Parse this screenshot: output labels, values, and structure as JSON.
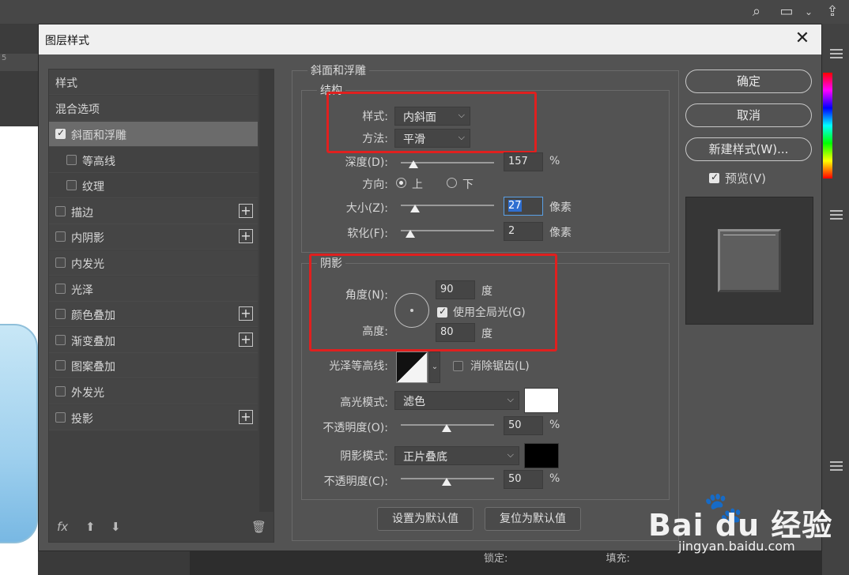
{
  "dialog": {
    "title": "图层样式",
    "close_glyph": "✕"
  },
  "styles_list": {
    "header": "样式",
    "blend_options": "混合选项",
    "items": [
      {
        "label": "斜面和浮雕",
        "checked": true,
        "selected": true,
        "plus": false,
        "indent": false
      },
      {
        "label": "等高线",
        "checked": false,
        "selected": false,
        "plus": false,
        "indent": true
      },
      {
        "label": "纹理",
        "checked": false,
        "selected": false,
        "plus": false,
        "indent": true
      },
      {
        "label": "描边",
        "checked": false,
        "selected": false,
        "plus": true,
        "indent": false
      },
      {
        "label": "内阴影",
        "checked": false,
        "selected": false,
        "plus": true,
        "indent": false
      },
      {
        "label": "内发光",
        "checked": false,
        "selected": false,
        "plus": false,
        "indent": false
      },
      {
        "label": "光泽",
        "checked": false,
        "selected": false,
        "plus": false,
        "indent": false
      },
      {
        "label": "颜色叠加",
        "checked": false,
        "selected": false,
        "plus": true,
        "indent": false
      },
      {
        "label": "渐变叠加",
        "checked": false,
        "selected": false,
        "plus": true,
        "indent": false
      },
      {
        "label": "图案叠加",
        "checked": false,
        "selected": false,
        "plus": false,
        "indent": false
      },
      {
        "label": "外发光",
        "checked": false,
        "selected": false,
        "plus": false,
        "indent": false
      },
      {
        "label": "投影",
        "checked": false,
        "selected": false,
        "plus": true,
        "indent": false
      }
    ],
    "footer": {
      "fx": "fx",
      "up": "⬆",
      "down": "⬇",
      "trash": "🗑"
    }
  },
  "bevel": {
    "section_title": "斜面和浮雕",
    "structure": {
      "title": "结构",
      "style_label": "样式:",
      "style_value": "内斜面",
      "technique_label": "方法:",
      "technique_value": "平滑",
      "depth_label": "深度(D):",
      "depth_value": "157",
      "depth_unit": "%",
      "direction_label": "方向:",
      "direction_up": "上",
      "direction_down": "下",
      "size_label": "大小(Z):",
      "size_value": "27",
      "size_unit": "像素",
      "soften_label": "软化(F):",
      "soften_value": "2",
      "soften_unit": "像素"
    },
    "shading": {
      "title": "阴影",
      "angle_label": "角度(N):",
      "angle_value": "90",
      "angle_unit": "度",
      "global_light_label": "使用全局光(G)",
      "altitude_label": "高度:",
      "altitude_value": "80",
      "altitude_unit": "度",
      "gloss_contour_label": "光泽等高线:",
      "antialias_label": "消除锯齿(L)",
      "highlight_mode_label": "高光模式:",
      "highlight_mode_value": "滤色",
      "highlight_color": "#ffffff",
      "highlight_opacity_label": "不透明度(O):",
      "highlight_opacity_value": "50",
      "highlight_opacity_unit": "%",
      "shadow_mode_label": "阴影模式:",
      "shadow_mode_value": "正片叠底",
      "shadow_color": "#000000",
      "shadow_opacity_label": "不透明度(C):",
      "shadow_opacity_value": "50",
      "shadow_opacity_unit": "%"
    },
    "make_default": "设置为默认值",
    "reset_default": "复位为默认值"
  },
  "right_column": {
    "ok": "确定",
    "cancel": "取消",
    "new_style": "新建样式(W)...",
    "preview_label": "预览(V)"
  },
  "background": {
    "ruler_tick": "5",
    "lock_label": "锁定:",
    "fill_label": "填充:"
  },
  "watermark": {
    "brand": "Bai du 经验",
    "url": "jingyan.baidu.com"
  },
  "colors": {
    "dialog_bg": "#535353",
    "highlight_box": "#e0201f",
    "selection_bg": "#6b6b6b"
  }
}
